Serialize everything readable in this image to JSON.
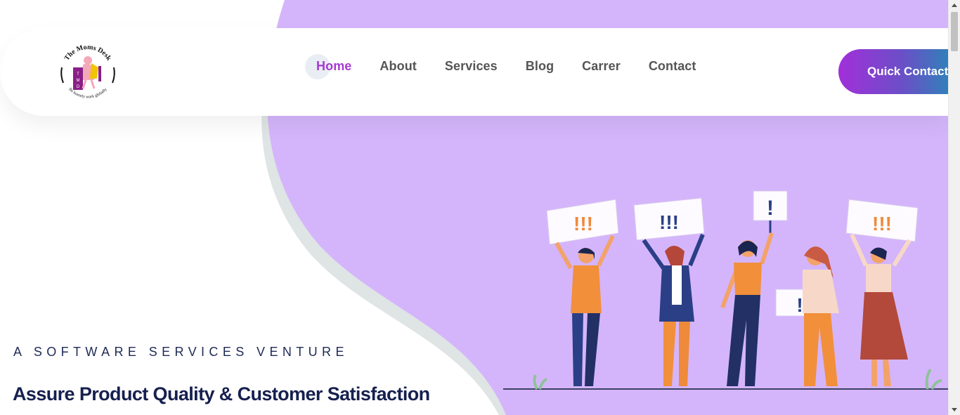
{
  "colors": {
    "brand_purple": "#a63ad0",
    "blob_lavender": "#d4b5fb",
    "blob_grey": "#dfe4e4",
    "heading_navy": "#16204f",
    "nav_text": "#555555"
  },
  "logo": {
    "brand_name": "The Moms Desk",
    "tagline": "Be homely work globally",
    "initials": [
      "T",
      "M",
      "D"
    ]
  },
  "nav": {
    "items": [
      {
        "label": "Home",
        "active": true
      },
      {
        "label": "About",
        "active": false
      },
      {
        "label": "Services",
        "active": false
      },
      {
        "label": "Blog",
        "active": false
      },
      {
        "label": "Carrer",
        "active": false
      },
      {
        "label": "Contact",
        "active": false
      }
    ]
  },
  "cta": {
    "quick_contact_label": "Quick Contact"
  },
  "hero": {
    "tagline": "A SOFTWARE SERVICES VENTURE",
    "headline": "Assure Product Quality & Customer Satisfaction",
    "signs": [
      "!!!",
      "!!!",
      "!",
      "!!!",
      "!"
    ]
  }
}
